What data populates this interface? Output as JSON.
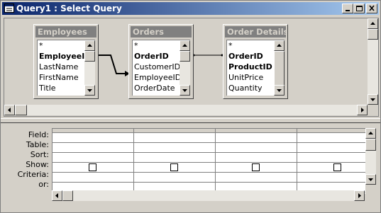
{
  "window": {
    "title": "Query1 : Select Query",
    "title_color": "#0a246a"
  },
  "tables": [
    {
      "name": "Employees",
      "fields": [
        {
          "label": "*",
          "key": false
        },
        {
          "label": "EmployeeID",
          "key": true
        },
        {
          "label": "LastName",
          "key": false
        },
        {
          "label": "FirstName",
          "key": false
        },
        {
          "label": "Title",
          "key": false
        }
      ]
    },
    {
      "name": "Orders",
      "fields": [
        {
          "label": "*",
          "key": false
        },
        {
          "label": "OrderID",
          "key": true
        },
        {
          "label": "CustomerID",
          "key": false
        },
        {
          "label": "EmployeeID",
          "key": false
        },
        {
          "label": "OrderDate",
          "key": false
        }
      ]
    },
    {
      "name": "Order Details",
      "fields": [
        {
          "label": "*",
          "key": false
        },
        {
          "label": "OrderID",
          "key": true
        },
        {
          "label": "ProductID",
          "key": true
        },
        {
          "label": "UnitPrice",
          "key": false
        },
        {
          "label": "Quantity",
          "key": false
        }
      ]
    }
  ],
  "grid": {
    "row_labels": [
      "Field:",
      "Table:",
      "Sort:",
      "Show:",
      "Criteria:",
      "or:"
    ],
    "columns": 4,
    "show_checked": [
      false,
      false,
      false,
      false
    ]
  },
  "icons": {
    "window": "query-icon",
    "minimize": "minimize-icon",
    "maximize": "maximize-icon",
    "close": "close-icon"
  }
}
